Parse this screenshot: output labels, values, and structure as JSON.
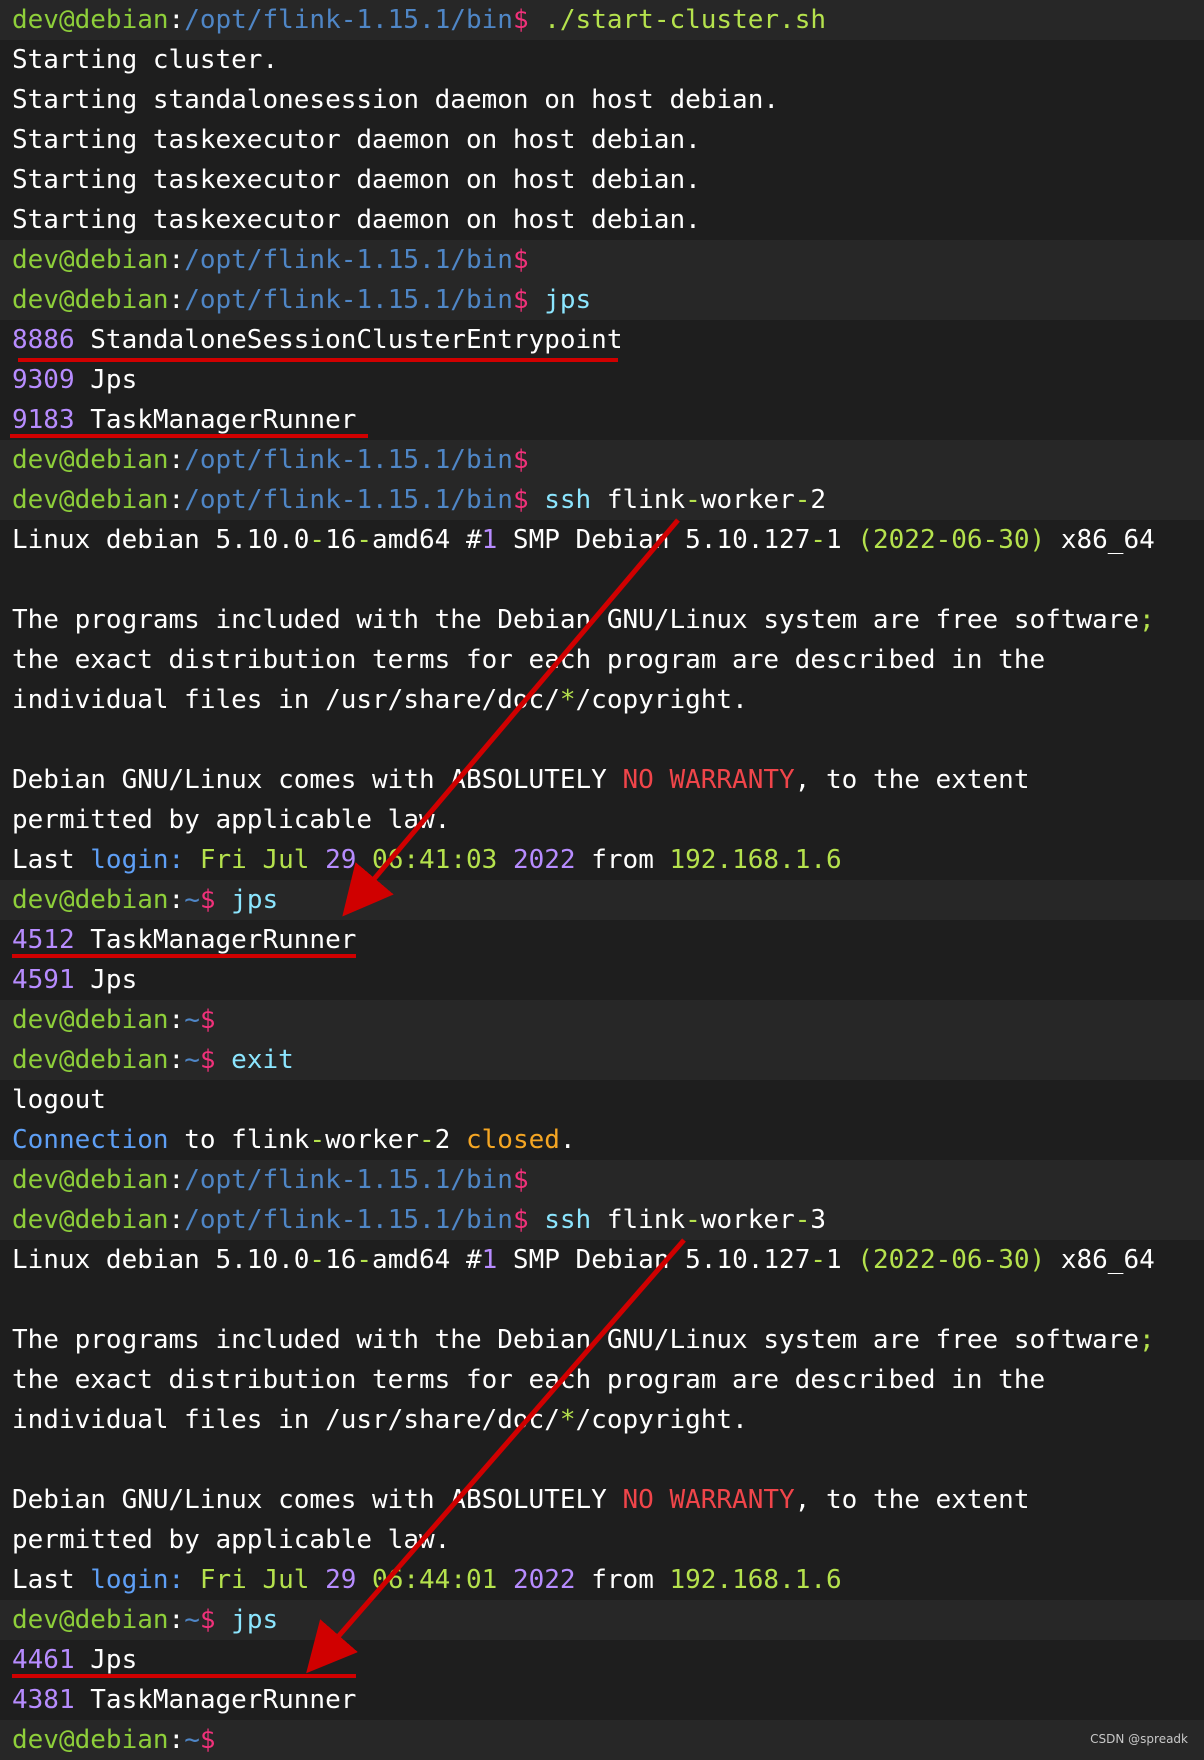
{
  "colors": {
    "user": "#8ecf3a",
    "path": "#4f86c6",
    "sign": "#f0317a",
    "cmd": "#8ce6ff",
    "text": "#ffffff",
    "pid": "#b78cff",
    "num": "#b78cff",
    "green": "#b5e24d",
    "red": "#f0454a",
    "blue": "#5e9ff5",
    "orange": "#f5a623",
    "annotation": "#d00000",
    "background": "#1e1e1e",
    "prompt_bg": "#272727"
  },
  "watermark": "CSDN @spreadk",
  "lines": [
    {
      "type": "cmd",
      "segs": [
        {
          "t": "dev@debian",
          "c": "user"
        },
        {
          "t": ":",
          "c": "text"
        },
        {
          "t": "/opt/flink-1.15.1/bin",
          "c": "path"
        },
        {
          "t": "$",
          "c": "sign"
        },
        {
          "t": " ./start-cluster.sh",
          "c": "green"
        }
      ]
    },
    {
      "type": "out",
      "segs": [
        {
          "t": "Starting cluster.",
          "c": "text"
        }
      ]
    },
    {
      "type": "out",
      "segs": [
        {
          "t": "Starting standalonesession daemon on host debian.",
          "c": "text"
        }
      ]
    },
    {
      "type": "out",
      "segs": [
        {
          "t": "Starting taskexecutor daemon on host debian.",
          "c": "text"
        }
      ]
    },
    {
      "type": "out",
      "segs": [
        {
          "t": "Starting taskexecutor daemon on host debian.",
          "c": "text"
        }
      ]
    },
    {
      "type": "out",
      "segs": [
        {
          "t": "Starting taskexecutor daemon on host debian.",
          "c": "text"
        }
      ]
    },
    {
      "type": "cmd",
      "segs": [
        {
          "t": "dev@debian",
          "c": "user"
        },
        {
          "t": ":",
          "c": "text"
        },
        {
          "t": "/opt/flink-1.15.1/bin",
          "c": "path"
        },
        {
          "t": "$",
          "c": "sign"
        }
      ]
    },
    {
      "type": "cmd",
      "segs": [
        {
          "t": "dev@debian",
          "c": "user"
        },
        {
          "t": ":",
          "c": "text"
        },
        {
          "t": "/opt/flink-1.15.1/bin",
          "c": "path"
        },
        {
          "t": "$",
          "c": "sign"
        },
        {
          "t": " jps",
          "c": "cmd"
        }
      ]
    },
    {
      "type": "out",
      "segs": [
        {
          "t": "8886",
          "c": "pid"
        },
        {
          "t": " StandaloneSessionClusterEntrypoint",
          "c": "text"
        }
      ]
    },
    {
      "type": "out",
      "segs": [
        {
          "t": "9309",
          "c": "pid"
        },
        {
          "t": " Jps",
          "c": "text"
        }
      ]
    },
    {
      "type": "out",
      "segs": [
        {
          "t": "9183",
          "c": "pid"
        },
        {
          "t": " TaskManagerRunner",
          "c": "text"
        }
      ]
    },
    {
      "type": "cmd",
      "segs": [
        {
          "t": "dev@debian",
          "c": "user"
        },
        {
          "t": ":",
          "c": "text"
        },
        {
          "t": "/opt/flink-1.15.1/bin",
          "c": "path"
        },
        {
          "t": "$",
          "c": "sign"
        }
      ]
    },
    {
      "type": "cmd",
      "segs": [
        {
          "t": "dev@debian",
          "c": "user"
        },
        {
          "t": ":",
          "c": "text"
        },
        {
          "t": "/opt/flink-1.15.1/bin",
          "c": "path"
        },
        {
          "t": "$",
          "c": "sign"
        },
        {
          "t": " ssh",
          "c": "cmd"
        },
        {
          "t": " flink",
          "c": "text"
        },
        {
          "t": "-",
          "c": "green"
        },
        {
          "t": "worker",
          "c": "text"
        },
        {
          "t": "-",
          "c": "green"
        },
        {
          "t": "2",
          "c": "text"
        }
      ]
    },
    {
      "type": "out",
      "segs": [
        {
          "t": "Linux debian 5.10.0",
          "c": "text"
        },
        {
          "t": "-",
          "c": "green"
        },
        {
          "t": "16",
          "c": "text"
        },
        {
          "t": "-",
          "c": "green"
        },
        {
          "t": "amd64 #",
          "c": "text"
        },
        {
          "t": "1",
          "c": "num"
        },
        {
          "t": " SMP Debian 5.10.127",
          "c": "text"
        },
        {
          "t": "-",
          "c": "green"
        },
        {
          "t": "1 ",
          "c": "text"
        },
        {
          "t": "(2022-06-30)",
          "c": "green"
        },
        {
          "t": " x86_64",
          "c": "text"
        }
      ]
    },
    {
      "type": "out",
      "segs": []
    },
    {
      "type": "out",
      "segs": [
        {
          "t": "The programs included with the Debian GNU/Linux system are free software",
          "c": "text"
        },
        {
          "t": ";",
          "c": "green"
        }
      ]
    },
    {
      "type": "out",
      "segs": [
        {
          "t": "the exact distribution terms for each program are described in the",
          "c": "text"
        }
      ]
    },
    {
      "type": "out",
      "segs": [
        {
          "t": "individual files in /usr/share/doc/",
          "c": "text"
        },
        {
          "t": "*",
          "c": "green"
        },
        {
          "t": "/copyright.",
          "c": "text"
        }
      ]
    },
    {
      "type": "out",
      "segs": []
    },
    {
      "type": "out",
      "segs": [
        {
          "t": "Debian GNU/Linux comes with ABSOLUTELY ",
          "c": "text"
        },
        {
          "t": "NO WARRANTY",
          "c": "red"
        },
        {
          "t": ", to the extent",
          "c": "text"
        }
      ]
    },
    {
      "type": "out",
      "segs": [
        {
          "t": "permitted by applicable law.",
          "c": "text"
        }
      ]
    },
    {
      "type": "out",
      "segs": [
        {
          "t": "Last ",
          "c": "text"
        },
        {
          "t": "login:",
          "c": "blue"
        },
        {
          "t": " Fri Jul ",
          "c": "green"
        },
        {
          "t": "29",
          "c": "num"
        },
        {
          "t": " 06:41:03 ",
          "c": "green"
        },
        {
          "t": "2022",
          "c": "num"
        },
        {
          "t": " from ",
          "c": "text"
        },
        {
          "t": "192.168.1.6",
          "c": "green"
        }
      ]
    },
    {
      "type": "cmd",
      "segs": [
        {
          "t": "dev@debian",
          "c": "user"
        },
        {
          "t": ":",
          "c": "text"
        },
        {
          "t": "~",
          "c": "path"
        },
        {
          "t": "$",
          "c": "sign"
        },
        {
          "t": " jps",
          "c": "cmd"
        }
      ]
    },
    {
      "type": "out",
      "segs": [
        {
          "t": "4512",
          "c": "pid"
        },
        {
          "t": " TaskManagerRunner",
          "c": "text"
        }
      ]
    },
    {
      "type": "out",
      "segs": [
        {
          "t": "4591",
          "c": "pid"
        },
        {
          "t": " Jps",
          "c": "text"
        }
      ]
    },
    {
      "type": "cmd",
      "segs": [
        {
          "t": "dev@debian",
          "c": "user"
        },
        {
          "t": ":",
          "c": "text"
        },
        {
          "t": "~",
          "c": "path"
        },
        {
          "t": "$",
          "c": "sign"
        }
      ]
    },
    {
      "type": "cmd",
      "segs": [
        {
          "t": "dev@debian",
          "c": "user"
        },
        {
          "t": ":",
          "c": "text"
        },
        {
          "t": "~",
          "c": "path"
        },
        {
          "t": "$",
          "c": "sign"
        },
        {
          "t": " exit",
          "c": "cmd"
        }
      ]
    },
    {
      "type": "out",
      "segs": [
        {
          "t": "logout",
          "c": "text"
        }
      ]
    },
    {
      "type": "out",
      "segs": [
        {
          "t": "Connection",
          "c": "blue"
        },
        {
          "t": " to flink",
          "c": "text"
        },
        {
          "t": "-",
          "c": "green"
        },
        {
          "t": "worker",
          "c": "text"
        },
        {
          "t": "-",
          "c": "green"
        },
        {
          "t": "2 ",
          "c": "text"
        },
        {
          "t": "closed",
          "c": "orange"
        },
        {
          "t": ".",
          "c": "text"
        }
      ]
    },
    {
      "type": "cmd",
      "segs": [
        {
          "t": "dev@debian",
          "c": "user"
        },
        {
          "t": ":",
          "c": "text"
        },
        {
          "t": "/opt/flink-1.15.1/bin",
          "c": "path"
        },
        {
          "t": "$",
          "c": "sign"
        }
      ]
    },
    {
      "type": "cmd",
      "segs": [
        {
          "t": "dev@debian",
          "c": "user"
        },
        {
          "t": ":",
          "c": "text"
        },
        {
          "t": "/opt/flink-1.15.1/bin",
          "c": "path"
        },
        {
          "t": "$",
          "c": "sign"
        },
        {
          "t": " ssh",
          "c": "cmd"
        },
        {
          "t": " flink",
          "c": "text"
        },
        {
          "t": "-",
          "c": "green"
        },
        {
          "t": "worker",
          "c": "text"
        },
        {
          "t": "-",
          "c": "green"
        },
        {
          "t": "3",
          "c": "text"
        }
      ]
    },
    {
      "type": "out",
      "segs": [
        {
          "t": "Linux debian 5.10.0",
          "c": "text"
        },
        {
          "t": "-",
          "c": "green"
        },
        {
          "t": "16",
          "c": "text"
        },
        {
          "t": "-",
          "c": "green"
        },
        {
          "t": "amd64 #",
          "c": "text"
        },
        {
          "t": "1",
          "c": "num"
        },
        {
          "t": " SMP Debian 5.10.127",
          "c": "text"
        },
        {
          "t": "-",
          "c": "green"
        },
        {
          "t": "1 ",
          "c": "text"
        },
        {
          "t": "(2022-06-30)",
          "c": "green"
        },
        {
          "t": " x86_64",
          "c": "text"
        }
      ]
    },
    {
      "type": "out",
      "segs": []
    },
    {
      "type": "out",
      "segs": [
        {
          "t": "The programs included with the Debian GNU/Linux system are free software",
          "c": "text"
        },
        {
          "t": ";",
          "c": "green"
        }
      ]
    },
    {
      "type": "out",
      "segs": [
        {
          "t": "the exact distribution terms for each program are described in the",
          "c": "text"
        }
      ]
    },
    {
      "type": "out",
      "segs": [
        {
          "t": "individual files in /usr/share/doc/",
          "c": "text"
        },
        {
          "t": "*",
          "c": "green"
        },
        {
          "t": "/copyright.",
          "c": "text"
        }
      ]
    },
    {
      "type": "out",
      "segs": []
    },
    {
      "type": "out",
      "segs": [
        {
          "t": "Debian GNU/Linux comes with ABSOLUTELY ",
          "c": "text"
        },
        {
          "t": "NO WARRANTY",
          "c": "red"
        },
        {
          "t": ", to the extent",
          "c": "text"
        }
      ]
    },
    {
      "type": "out",
      "segs": [
        {
          "t": "permitted by applicable law.",
          "c": "text"
        }
      ]
    },
    {
      "type": "out",
      "segs": [
        {
          "t": "Last ",
          "c": "text"
        },
        {
          "t": "login:",
          "c": "blue"
        },
        {
          "t": " Fri Jul ",
          "c": "green"
        },
        {
          "t": "29",
          "c": "num"
        },
        {
          "t": " 06:44:01 ",
          "c": "green"
        },
        {
          "t": "2022",
          "c": "num"
        },
        {
          "t": " from ",
          "c": "text"
        },
        {
          "t": "192.168.1.6",
          "c": "green"
        }
      ]
    },
    {
      "type": "cmd",
      "segs": [
        {
          "t": "dev@debian",
          "c": "user"
        },
        {
          "t": ":",
          "c": "text"
        },
        {
          "t": "~",
          "c": "path"
        },
        {
          "t": "$",
          "c": "sign"
        },
        {
          "t": " jps",
          "c": "cmd"
        }
      ]
    },
    {
      "type": "out",
      "segs": [
        {
          "t": "4461",
          "c": "pid"
        },
        {
          "t": " Jps",
          "c": "text"
        }
      ]
    },
    {
      "type": "out",
      "segs": [
        {
          "t": "4381",
          "c": "pid"
        },
        {
          "t": " TaskManagerRunner",
          "c": "text"
        }
      ]
    },
    {
      "type": "cmd",
      "segs": [
        {
          "t": "dev@debian",
          "c": "user"
        },
        {
          "t": ":",
          "c": "text"
        },
        {
          "t": "~",
          "c": "path"
        },
        {
          "t": "$",
          "c": "sign"
        }
      ]
    }
  ]
}
